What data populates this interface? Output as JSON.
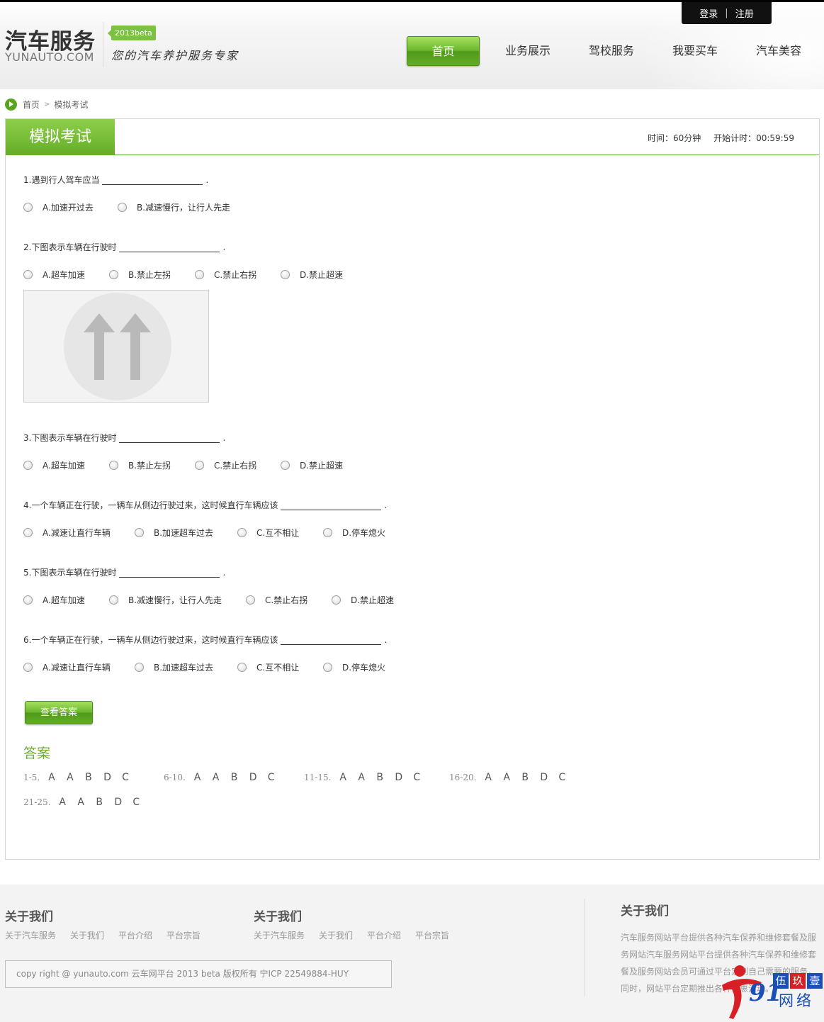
{
  "header": {
    "logo_title": "汽车服务",
    "logo_sub": "YUNAUTO.COM",
    "beta": "2013beta",
    "slogan": "您的汽车养护服务专家",
    "login": "登录",
    "login_sep": "|",
    "register": "注册",
    "nav": [
      "首页",
      "业务展示",
      "驾校服务",
      "我要买车",
      "汽车美容"
    ],
    "colors": {
      "accent_green": "#6bb72c",
      "topbar": "#111111"
    }
  },
  "breadcrumb": {
    "home": "首页",
    "sep": ">",
    "current": "模拟考试"
  },
  "exam": {
    "title": "模拟考试",
    "time_label": "时间：60分钟",
    "countdown_label": "开始计时：00:59:59",
    "questions": [
      {
        "text": "1.遇到行人驾车应当",
        "options": [
          "A.加速开过去",
          "B.减速慢行，让行人先走"
        ]
      },
      {
        "text": "2.下图表示车辆在行驶时",
        "options": [
          "A.超车加速",
          "B.禁止左拐",
          "C.禁止右拐",
          "D.禁止超速"
        ]
      },
      {
        "text": "3.下图表示车辆在行驶时",
        "options": [
          "A.超车加速",
          "B.禁止左拐",
          "C.禁止右拐",
          "D.禁止超速"
        ]
      },
      {
        "text": "4.一个车辆正在行驶，一辆车从侧边行驶过来，这时候直行车辆应该",
        "options": [
          "A.减速让直行车辆",
          "B.加速超车过去",
          "C.互不相让",
          "D.停车熄火"
        ]
      },
      {
        "text": "5.下图表示车辆在行驶时",
        "options": [
          "A.超车加速",
          "B.减速慢行，让行人先走",
          "C.禁止右拐",
          "D.禁止超速"
        ]
      },
      {
        "text": "6.一个车辆正在行驶，一辆车从侧边行驶过来，这时候直行车辆应该",
        "options": [
          "A.减速让直行车辆",
          "B.加速超车过去",
          "C.互不相让",
          "D.停车熄火"
        ]
      }
    ],
    "dot": ".",
    "sign_image": "straight-arrows-sign-icon",
    "answer_button": "查看答案",
    "answer_title": "答案",
    "answers": [
      {
        "range": "1-5.",
        "letters": [
          "A",
          "A",
          "B",
          "D",
          "C"
        ]
      },
      {
        "range": "6-10.",
        "letters": [
          "A",
          "A",
          "B",
          "D",
          "C"
        ]
      },
      {
        "range": "11-15.",
        "letters": [
          "A",
          "A",
          "B",
          "D",
          "C"
        ]
      },
      {
        "range": "16-20.",
        "letters": [
          "A",
          "A",
          "B",
          "D",
          "C"
        ]
      },
      {
        "range": "21-25.",
        "letters": [
          "A",
          "A",
          "B",
          "D",
          "C"
        ]
      }
    ]
  },
  "footer": {
    "col1_title": "关于我们",
    "col1_links": [
      "关于汽车服务",
      "关于我们",
      "平台介绍",
      "平台宗旨"
    ],
    "col2_title": "关于我们",
    "col2_links": [
      "关于汽车服务",
      "关于我们",
      "平台介绍",
      "平台宗旨"
    ],
    "copyright": "copy right @ yunauto.com 云车网平台 2013 beta 版权所有 宁ICP 22549884-HUY",
    "col3_title": "关于我们",
    "col3_text": "汽车服务网站平台提供各种汽车保养和维修套餐及服务网站汽车服务网站平台提供各种汽车保养和维修套餐及服务网站会员可通过平台定制自己需要的服务，同时，网站平台定期推出各种优惠活动。"
  },
  "watermark": {
    "num": "91",
    "chars": [
      "伍",
      "玖",
      "壹"
    ],
    "net": "网络",
    "colors": {
      "red": "#d71f26",
      "blue": "#1a4fb8"
    }
  }
}
